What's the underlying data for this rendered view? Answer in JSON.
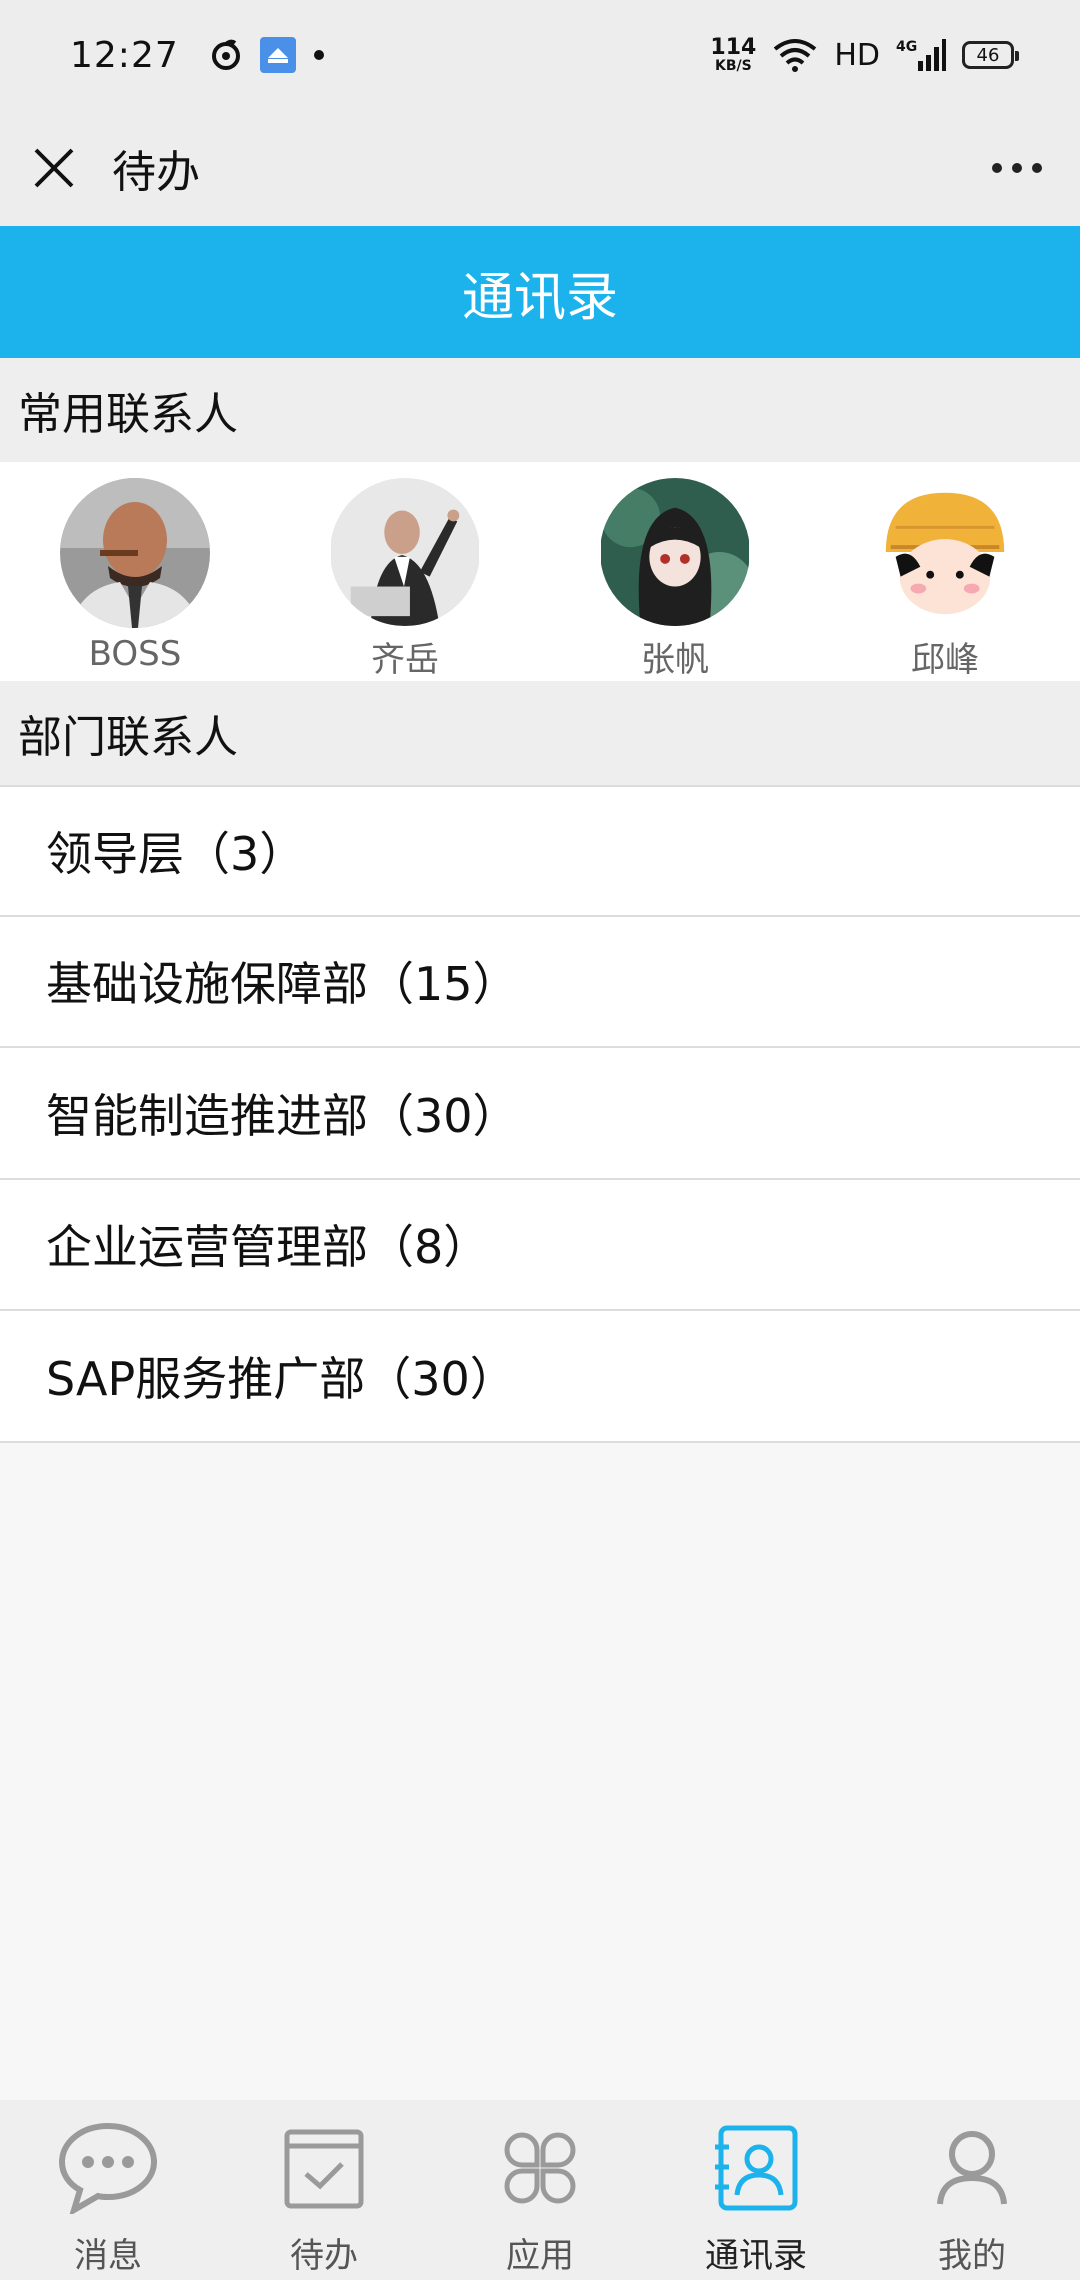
{
  "status_bar": {
    "time": "12:27",
    "net_speed_value": "114",
    "net_speed_unit": "KB/S",
    "hd": "HD",
    "network": "4G",
    "battery": "46"
  },
  "header": {
    "title": "待办"
  },
  "title_bar": {
    "title": "通讯录"
  },
  "frequent": {
    "header": "常用联系人",
    "contacts": [
      {
        "name": "BOSS"
      },
      {
        "name": "齐岳"
      },
      {
        "name": "张帆"
      },
      {
        "name": "邱峰"
      }
    ]
  },
  "departments": {
    "header": "部门联系人",
    "items": [
      {
        "label": "领导层（3）"
      },
      {
        "label": "基础设施保障部（15）"
      },
      {
        "label": "智能制造推进部（30）"
      },
      {
        "label": "企业运营管理部（8）"
      },
      {
        "label": "SAP服务推广部（30）"
      }
    ]
  },
  "bottom_nav": {
    "items": [
      {
        "label": "消息",
        "icon": "chat-icon"
      },
      {
        "label": "待办",
        "icon": "todo-icon"
      },
      {
        "label": "应用",
        "icon": "apps-icon"
      },
      {
        "label": "通讯录",
        "icon": "contacts-icon"
      },
      {
        "label": "我的",
        "icon": "profile-icon"
      }
    ],
    "active_color": "#1cb2ec"
  },
  "colors": {
    "accent": "#1cb2ec",
    "section_bg": "#eeeeee",
    "page_bg": "#f7f7f7"
  }
}
